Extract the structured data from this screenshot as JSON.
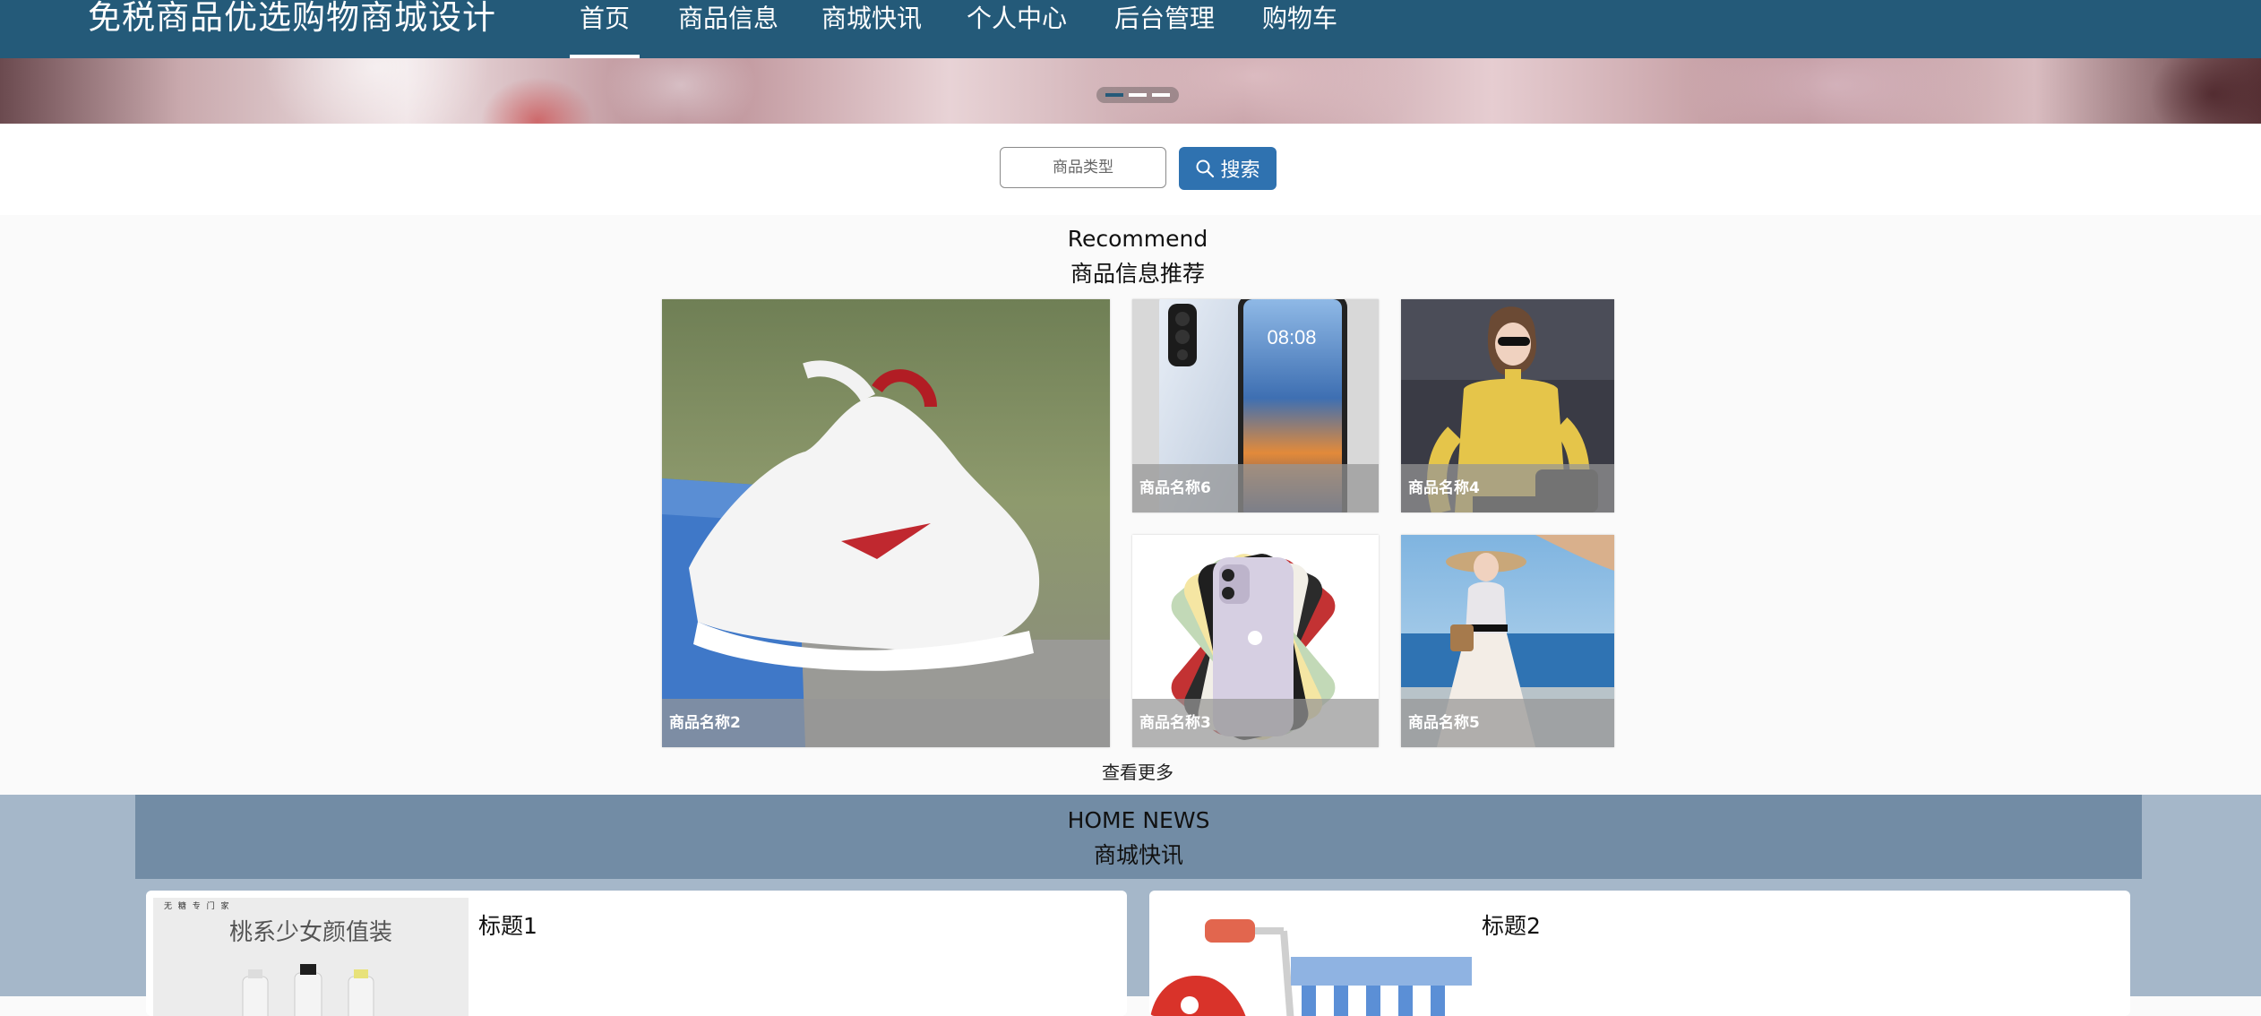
{
  "header": {
    "site_title": "免税商品优选购物商城设计",
    "nav": [
      {
        "label": "首页",
        "active": true
      },
      {
        "label": "商品信息"
      },
      {
        "label": "商城快讯"
      },
      {
        "label": "个人中心"
      },
      {
        "label": "后台管理"
      },
      {
        "label": "购物车"
      }
    ]
  },
  "banner": {
    "slides_count": 3,
    "active_slide": 1
  },
  "search": {
    "placeholder": "商品类型",
    "value": "",
    "button_label": "搜索",
    "button_icon": "search-icon"
  },
  "recommend": {
    "title_en": "Recommend",
    "title_zh": "商品信息推荐",
    "items": [
      {
        "name": "商品名称2",
        "image": "white-red-sneakers-on-shoebox"
      },
      {
        "name": "商品名称6",
        "image": "smartphone-front-and-back"
      },
      {
        "name": "商品名称4",
        "image": "woman-yellow-sweater-sunglasses"
      },
      {
        "name": "商品名称3",
        "image": "smartphone-color-fan"
      },
      {
        "name": "商品名称5",
        "image": "woman-white-lace-dress-beach"
      }
    ],
    "more_label": "查看更多"
  },
  "news": {
    "title_en": "HOME NEWS",
    "title_zh": "商城快讯",
    "items": [
      {
        "title": "标题1",
        "thumb_text": "桃系少女颜值装",
        "thumb_small_text": "无 糖 专 门 家"
      },
      {
        "title": "标题2"
      }
    ]
  },
  "colors": {
    "header_bg": "#245a79",
    "search_button": "#2f72b0",
    "news_bg": "#a5b7c9",
    "news_header_bg": "#728ca5",
    "caption_overlay": "rgba(150,150,150,0.72)"
  }
}
